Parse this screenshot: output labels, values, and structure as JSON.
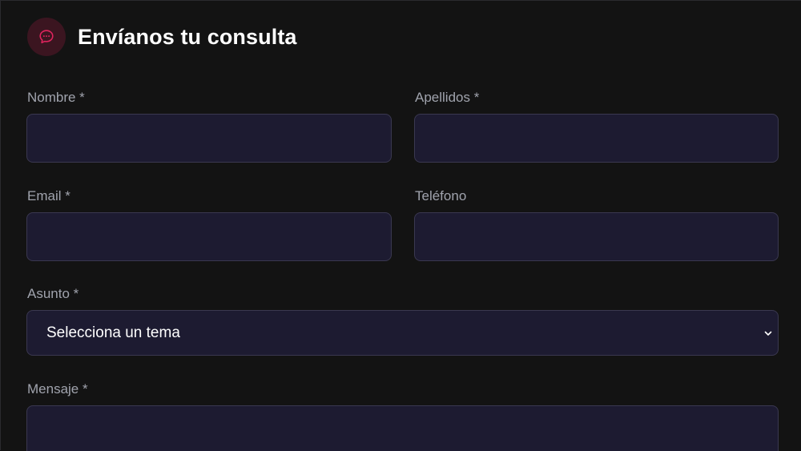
{
  "form": {
    "title": "Envíanos tu consulta",
    "icon": "chat-bubble-icon",
    "accent_color": "#e0245e",
    "fields": {
      "nombre": {
        "label": "Nombre *",
        "value": ""
      },
      "apellidos": {
        "label": "Apellidos *",
        "value": ""
      },
      "email": {
        "label": "Email *",
        "value": ""
      },
      "telefono": {
        "label": "Teléfono",
        "value": ""
      },
      "asunto": {
        "label": "Asunto *",
        "selected": "Selecciona un tema"
      },
      "mensaje": {
        "label": "Mensaje *",
        "value": ""
      }
    }
  }
}
